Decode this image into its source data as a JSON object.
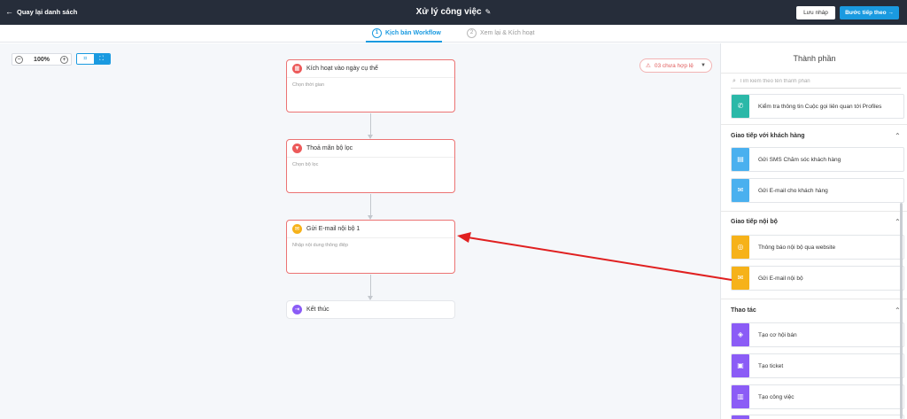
{
  "topbar": {
    "back_label": "Quay lại danh sách",
    "title": "Xử lý công việc",
    "draft_label": "Lưu nháp",
    "next_label": "Bước tiếp theo"
  },
  "stepper": [
    {
      "num": "1",
      "label": "Kịch bản Workflow",
      "active": true
    },
    {
      "num": "2",
      "label": "Xem lại & Kích hoạt",
      "active": false
    }
  ],
  "canvas": {
    "zoom": "100%",
    "invalid_label": "03 chưa hợp lệ",
    "nodes": [
      {
        "title": "Kích hoạt vào ngày cụ thể",
        "subtitle": "Chọn thời gian",
        "icon": "calendar-icon"
      },
      {
        "title": "Thoả mãn bộ lọc",
        "subtitle": "Chọn bộ lọc",
        "icon": "filter-icon"
      },
      {
        "title": "Gửi E-mail nội bộ 1",
        "subtitle": "Nhập nội dung thông điệp",
        "icon": "mail-icon"
      }
    ],
    "end_node": {
      "title": "Kết thúc",
      "icon": "exit-icon"
    }
  },
  "panel": {
    "title": "Thành phần",
    "search_placeholder": "Tìm kiếm theo tên thành phần",
    "top_item": "Kiểm tra thông tin Cuộc gọi liên quan tới Profiles",
    "sections": [
      {
        "title": "Giao tiếp với khách hàng",
        "items": [
          "Gửi SMS Chăm sóc khách hàng",
          "Gửi E-mail cho khách hàng"
        ]
      },
      {
        "title": "Giao tiếp nội bộ",
        "items": [
          "Thông báo nội bộ qua website",
          "Gửi E-mail nội bộ"
        ]
      },
      {
        "title": "Thao tác",
        "items": [
          "Tạo cơ hội bán",
          "Tạo ticket",
          "Tạo công việc"
        ]
      }
    ]
  },
  "colors": {
    "topbar": "#262d3a",
    "accent": "#1a9ae0",
    "error": "#ec5a5a",
    "annotation": "#e02020"
  }
}
